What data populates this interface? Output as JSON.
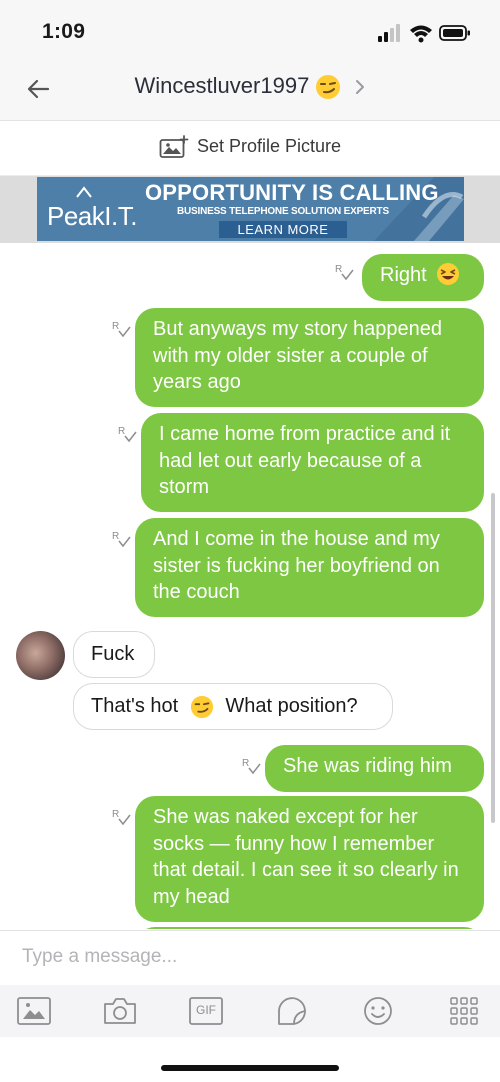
{
  "status": {
    "time": "1:09"
  },
  "header": {
    "title": "Wincestluver1997"
  },
  "profile": {
    "set_picture_label": "Set Profile Picture"
  },
  "ad": {
    "brand": "PeakI.T.",
    "headline": "OPPORTUNITY IS CALLING",
    "subline": "BUSINESS TELEPHONE SOLUTION EXPERTS",
    "cta": "LEARN MORE"
  },
  "messages": [
    {
      "direction": "outgoing",
      "text": "Right"
    },
    {
      "direction": "outgoing",
      "text": "But anyways my story happened with my older sister a couple of years ago"
    },
    {
      "direction": "outgoing",
      "text": "I came home from practice and it had let out early because of a storm"
    },
    {
      "direction": "outgoing",
      "text": "And I come in the house and my sister is fucking her boyfriend on the couch"
    },
    {
      "direction": "incoming",
      "text": "Fuck"
    },
    {
      "direction": "incoming",
      "text_before": "That's hot",
      "text_after": "What position?"
    },
    {
      "direction": "outgoing",
      "text": "She was riding him"
    },
    {
      "direction": "outgoing",
      "text": "She was naked except for her socks — funny how I remember that detail. I can see it so clearly in my head"
    }
  ],
  "composer": {
    "placeholder": "Type a message..."
  },
  "toolbar": {
    "gif_label": "GIF"
  },
  "colors": {
    "outgoing_bubble": "#7dc743",
    "accent": "#7dc743",
    "receipt_icon": "#8d8d92"
  }
}
